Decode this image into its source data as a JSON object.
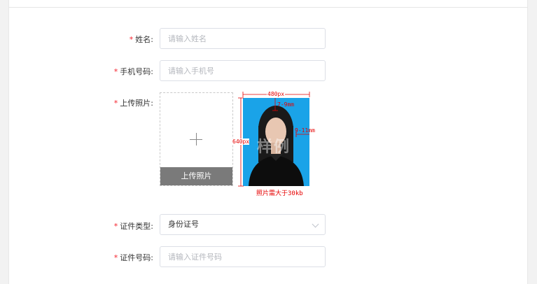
{
  "form": {
    "name": {
      "required": "*",
      "label": "姓名:",
      "placeholder": "请输入姓名"
    },
    "phone": {
      "required": "*",
      "label": "手机号码:",
      "placeholder": "请输入手机号"
    },
    "photo": {
      "required": "*",
      "label": "上传照片:",
      "upload_button": "上传照片",
      "sample": {
        "width_text": "480px",
        "height_text": "640px",
        "top_margin_text": "7-9mm",
        "side_margin_text": "9-11mm",
        "watermark": "样例",
        "caption": "照片需大于30kb"
      }
    },
    "id_type": {
      "required": "*",
      "label": "证件类型:",
      "value": "身份证号"
    },
    "id_number": {
      "required": "*",
      "label": "证件号码:",
      "placeholder": "请输入证件号码"
    }
  },
  "colors": {
    "required": "#f5222d",
    "sample_bg": "#1aa3e8",
    "annotation": "#e60000"
  }
}
